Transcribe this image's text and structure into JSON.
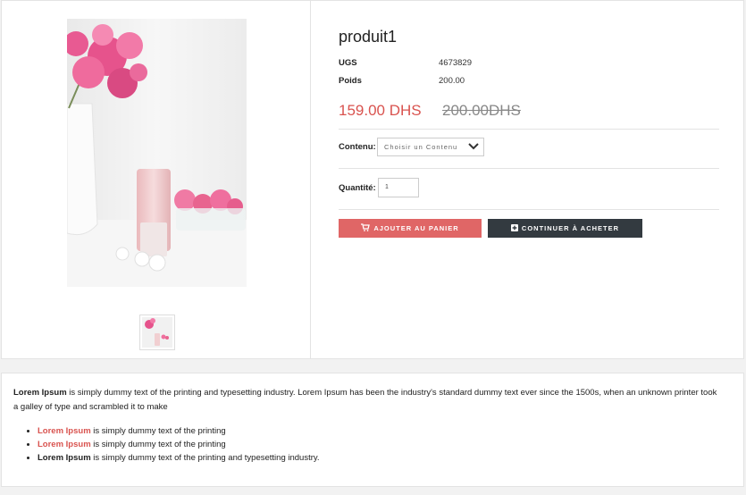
{
  "product": {
    "title": "produit1",
    "specs": [
      {
        "label": "UGS",
        "value": "4673829"
      },
      {
        "label": "Poids",
        "value": "200.00"
      }
    ],
    "price": "159.00 DHS",
    "old_price": "200.00DHS",
    "content_label": "Contenu:",
    "content_placeholder": "Choisir un Contenu",
    "quantity_label": "Quantité:",
    "quantity_value": "1",
    "add_to_cart_label": "Ajouter au panier",
    "continue_label": "Continuer à acheter"
  },
  "description": {
    "lead_bold": "Lorem Ipsum",
    "lead_text": " is simply dummy text of the printing and typesetting industry. Lorem Ipsum has been the industry's standard dummy text ever since the 1500s, when an unknown printer took a galley of type and scrambled it to make",
    "bullets": [
      {
        "bold": "Lorem Ipsum",
        "text": " is simply dummy text of the printing",
        "style": "red"
      },
      {
        "bold": "Lorem Ipsum",
        "text": " is simply dummy text of the printing",
        "style": "red"
      },
      {
        "bold": "Lorem Ipsum",
        "text": " is simply dummy text of the printing and typesetting industry.",
        "style": "black"
      }
    ]
  },
  "colors": {
    "accent": "#e06666",
    "price": "#d9534f",
    "dark_button": "#333a40"
  },
  "icons": [
    "cart-icon",
    "plus-square-icon",
    "chevron-down-icon"
  ]
}
